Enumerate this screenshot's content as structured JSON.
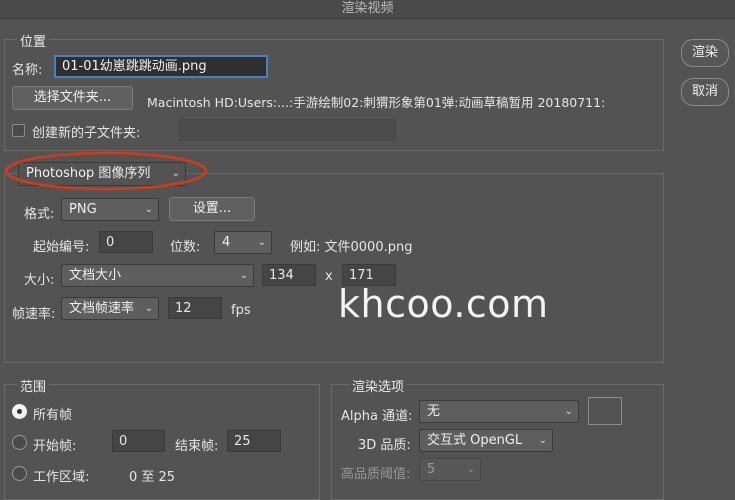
{
  "window": {
    "title": "渲染视频"
  },
  "actions": {
    "render_label": "渲染",
    "cancel_label": "取消"
  },
  "location": {
    "group_label": "位置",
    "name_label": "名称:",
    "name_value": "01-01幼崽跳跳动画.png",
    "choose_folder_label": "选择文件夹...",
    "folder_path": "Macintosh HD:Users:...:手游绘制02:刺猬形象第01弹:动画草稿暂用 20180711:",
    "subfolder_label": "创建新的子文件夹:",
    "subfolder_value": ""
  },
  "export": {
    "type_value": "Photoshop 图像序列",
    "format_label": "格式:",
    "format_value": "PNG",
    "settings_label": "设置...",
    "start_number_label": "起始编号:",
    "start_number_value": "0",
    "digits_label": "位数:",
    "digits_value": "4",
    "example_text": "例如: 文件0000.png",
    "size_label": "大小:",
    "size_value": "文档大小",
    "width_value": "134",
    "x_label": "x",
    "height_value": "171",
    "framerate_label": "帧速率:",
    "framerate_value": "文档帧速率",
    "fps_value": "12",
    "fps_label": "fps"
  },
  "watermark": "khcoo.com",
  "range": {
    "group_label": "范围",
    "all_frames_label": "所有帧",
    "start_frame_label": "开始帧:",
    "start_frame_value": "0",
    "end_frame_label": "结束帧:",
    "end_frame_value": "25",
    "work_area_label": "工作区域:",
    "work_area_value": "0 至 25"
  },
  "render_options": {
    "group_label": "渲染选项",
    "alpha_label": "Alpha 通道:",
    "alpha_value": "无",
    "quality_3d_label": "3D 品质:",
    "quality_3d_value": "交互式 OpenGL",
    "hq_threshold_label": "高品质阈值:",
    "hq_threshold_value": "5"
  },
  "colors": {
    "annotation_ring": "#d33a1c",
    "background": "#535353"
  }
}
